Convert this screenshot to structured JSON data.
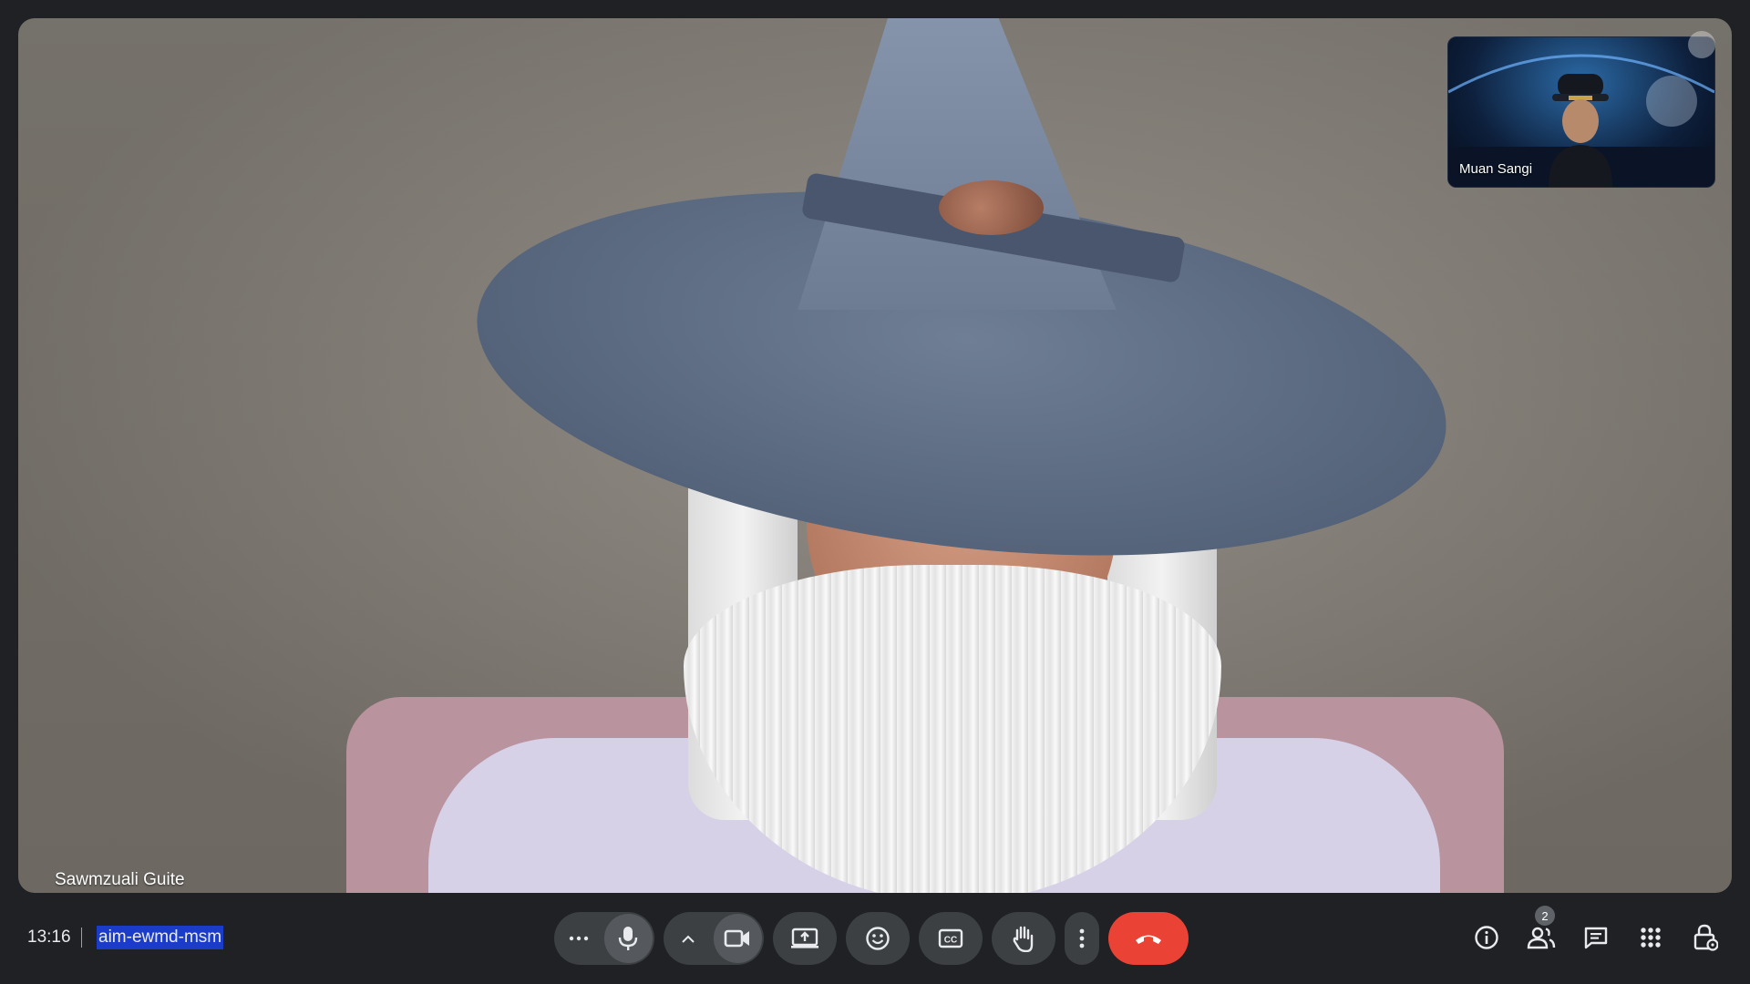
{
  "main_video": {
    "participant_name": "Sawmzuali Guite"
  },
  "self_view": {
    "participant_name": "Muan Sangi"
  },
  "bottom_bar": {
    "time": "13:16",
    "meeting_code": "aim-ewmd-msm",
    "people_count": "2"
  },
  "controls": [
    {
      "name": "more-effects-button",
      "icon": "ellipsis-icon"
    },
    {
      "name": "microphone-button",
      "icon": "mic-icon"
    },
    {
      "name": "camera-options-button",
      "icon": "chevron-up-icon"
    },
    {
      "name": "camera-button",
      "icon": "video-camera-icon"
    },
    {
      "name": "present-screen-button",
      "icon": "present-icon"
    },
    {
      "name": "reactions-button",
      "icon": "emoji-icon"
    },
    {
      "name": "captions-button",
      "icon": "captions-icon"
    },
    {
      "name": "raise-hand-button",
      "icon": "hand-icon"
    },
    {
      "name": "more-options-button",
      "icon": "vertical-dots-icon"
    },
    {
      "name": "leave-call-button",
      "icon": "hang-up-icon"
    }
  ],
  "right_toolbar": [
    {
      "name": "meeting-details-button",
      "icon": "info-icon"
    },
    {
      "name": "people-button",
      "icon": "people-icon"
    },
    {
      "name": "chat-button",
      "icon": "chat-icon"
    },
    {
      "name": "activities-button",
      "icon": "apps-grid-icon"
    },
    {
      "name": "host-controls-button",
      "icon": "lock-icon"
    }
  ],
  "colors": {
    "background": "#202124",
    "button": "#3c4043",
    "end_call": "#ea4335",
    "selection_highlight": "#1a3cc8"
  }
}
